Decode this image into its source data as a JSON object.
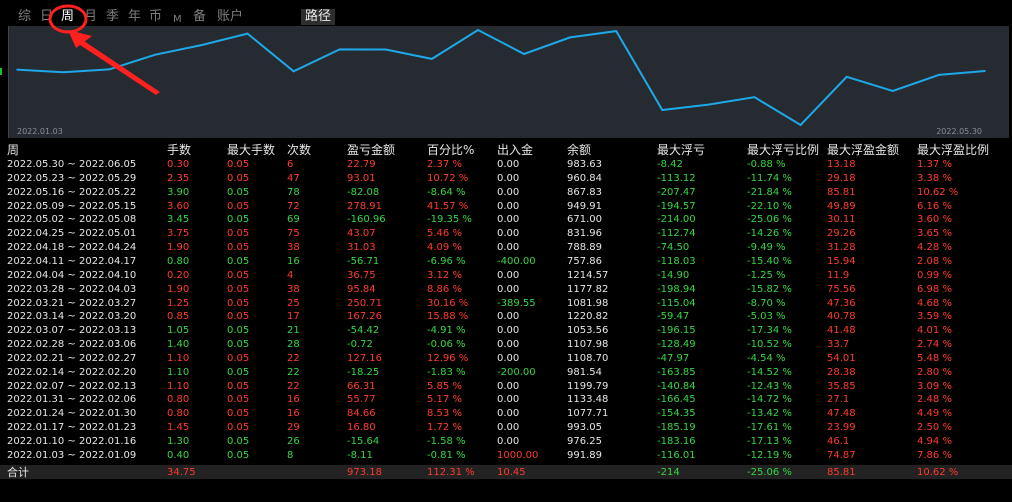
{
  "tabs": [
    "综",
    "日",
    "周",
    "月",
    "季",
    "年",
    "币",
    "M",
    "备",
    "账户"
  ],
  "active_tab": "周",
  "path_button": "路径",
  "chart_data": {
    "type": "line",
    "x_start_label": "2022.01.03",
    "x_end_label": "2022.05.30",
    "color": "#1ea8e8",
    "values": [
      991.89,
      976.25,
      993.05,
      1077.71,
      1133.48,
      1199.79,
      981.54,
      1108.7,
      1107.98,
      1053.56,
      1220.82,
      1081.98,
      1177.82,
      1214.57,
      757.86,
      788.89,
      831.96,
      671.0,
      949.91,
      867.83,
      960.84,
      983.63
    ]
  },
  "table": {
    "headers": [
      "周",
      "手数",
      "最大手数",
      "次数",
      "盈亏金额",
      "百分比%",
      "出入金",
      "余额",
      "最大浮亏",
      "最大浮亏比例",
      "最大浮盈金额",
      "最大浮盈比例"
    ],
    "rows": [
      [
        "2022.05.30 ~ 2022.06.05",
        "0.30",
        "0.05",
        "6",
        "22.79",
        "2.37 %",
        "0.00",
        "983.63",
        "-8.42",
        "-0.88 %",
        "13.18",
        "1.37 %"
      ],
      [
        "2022.05.23 ~ 2022.05.29",
        "2.35",
        "0.05",
        "47",
        "93.01",
        "10.72 %",
        "0.00",
        "960.84",
        "-113.12",
        "-11.74 %",
        "29.18",
        "3.38 %"
      ],
      [
        "2022.05.16 ~ 2022.05.22",
        "3.90",
        "0.05",
        "78",
        "-82.08",
        "-8.64 %",
        "0.00",
        "867.83",
        "-207.47",
        "-21.84 %",
        "85.81",
        "10.62 %"
      ],
      [
        "2022.05.09 ~ 2022.05.15",
        "3.60",
        "0.05",
        "72",
        "278.91",
        "41.57 %",
        "0.00",
        "949.91",
        "-194.57",
        "-22.10 %",
        "49.89",
        "6.16 %"
      ],
      [
        "2022.05.02 ~ 2022.05.08",
        "3.45",
        "0.05",
        "69",
        "-160.96",
        "-19.35 %",
        "0.00",
        "671.00",
        "-214.00",
        "-25.06 %",
        "30.11",
        "3.60 %"
      ],
      [
        "2022.04.25 ~ 2022.05.01",
        "3.75",
        "0.05",
        "75",
        "43.07",
        "5.46 %",
        "0.00",
        "831.96",
        "-112.74",
        "-14.26 %",
        "29.26",
        "3.65 %"
      ],
      [
        "2022.04.18 ~ 2022.04.24",
        "1.90",
        "0.05",
        "38",
        "31.03",
        "4.09 %",
        "0.00",
        "788.89",
        "-74.50",
        "-9.49 %",
        "31.28",
        "4.28 %"
      ],
      [
        "2022.04.11 ~ 2022.04.17",
        "0.80",
        "0.05",
        "16",
        "-56.71",
        "-6.96 %",
        "-400.00",
        "757.86",
        "-118.03",
        "-15.40 %",
        "15.94",
        "2.08 %"
      ],
      [
        "2022.04.04 ~ 2022.04.10",
        "0.20",
        "0.05",
        "4",
        "36.75",
        "3.12 %",
        "0.00",
        "1214.57",
        "-14.90",
        "-1.25 %",
        "11.9",
        "0.99 %"
      ],
      [
        "2022.03.28 ~ 2022.04.03",
        "1.90",
        "0.05",
        "38",
        "95.84",
        "8.86 %",
        "0.00",
        "1177.82",
        "-198.94",
        "-15.82 %",
        "75.56",
        "6.98 %"
      ],
      [
        "2022.03.21 ~ 2022.03.27",
        "1.25",
        "0.05",
        "25",
        "250.71",
        "30.16 %",
        "-389.55",
        "1081.98",
        "-115.04",
        "-8.70 %",
        "47.36",
        "4.68 %"
      ],
      [
        "2022.03.14 ~ 2022.03.20",
        "0.85",
        "0.05",
        "17",
        "167.26",
        "15.88 %",
        "0.00",
        "1220.82",
        "-59.47",
        "-5.03 %",
        "40.78",
        "3.59 %"
      ],
      [
        "2022.03.07 ~ 2022.03.13",
        "1.05",
        "0.05",
        "21",
        "-54.42",
        "-4.91 %",
        "0.00",
        "1053.56",
        "-196.15",
        "-17.34 %",
        "41.48",
        "4.01 %"
      ],
      [
        "2022.02.28 ~ 2022.03.06",
        "1.40",
        "0.05",
        "28",
        "-0.72",
        "-0.06 %",
        "0.00",
        "1107.98",
        "-128.49",
        "-10.52 %",
        "33.7",
        "2.74 %"
      ],
      [
        "2022.02.21 ~ 2022.02.27",
        "1.10",
        "0.05",
        "22",
        "127.16",
        "12.96 %",
        "0.00",
        "1108.70",
        "-47.97",
        "-4.54 %",
        "54.01",
        "5.48 %"
      ],
      [
        "2022.02.14 ~ 2022.02.20",
        "1.10",
        "0.05",
        "22",
        "-18.25",
        "-1.83 %",
        "-200.00",
        "981.54",
        "-163.85",
        "-14.52 %",
        "28.38",
        "2.80 %"
      ],
      [
        "2022.02.07 ~ 2022.02.13",
        "1.10",
        "0.05",
        "22",
        "66.31",
        "5.85 %",
        "0.00",
        "1199.79",
        "-140.84",
        "-12.43 %",
        "35.85",
        "3.09 %"
      ],
      [
        "2022.01.31 ~ 2022.02.06",
        "0.80",
        "0.05",
        "16",
        "55.77",
        "5.17 %",
        "0.00",
        "1133.48",
        "-166.45",
        "-14.72 %",
        "27.1",
        "2.48 %"
      ],
      [
        "2022.01.24 ~ 2022.01.30",
        "0.80",
        "0.05",
        "16",
        "84.66",
        "8.53 %",
        "0.00",
        "1077.71",
        "-154.35",
        "-13.42 %",
        "47.48",
        "4.49 %"
      ],
      [
        "2022.01.17 ~ 2022.01.23",
        "1.45",
        "0.05",
        "29",
        "16.80",
        "1.72 %",
        "0.00",
        "993.05",
        "-185.19",
        "-17.61 %",
        "23.99",
        "2.50 %"
      ],
      [
        "2022.01.10 ~ 2022.01.16",
        "1.30",
        "0.05",
        "26",
        "-15.64",
        "-1.58 %",
        "0.00",
        "976.25",
        "-183.16",
        "-17.13 %",
        "46.1",
        "4.94 %"
      ],
      [
        "2022.01.03 ~ 2022.01.09",
        "0.40",
        "0.05",
        "8",
        "-8.11",
        "-0.81 %",
        "1000.00",
        "991.89",
        "-116.01",
        "-12.19 %",
        "74.87",
        "7.86 %"
      ]
    ],
    "total": [
      "合计",
      "34.75",
      "",
      "",
      "973.18",
      "112.31 %",
      "10.45",
      "",
      "-214",
      "-25.06 %",
      "85.81",
      "10.62 %"
    ]
  },
  "colors": {
    "positive": "#ff3b30",
    "negative": "#36d645",
    "neutral": "#e6e6e6",
    "annotation": "#ff2020",
    "line": "#1ea8e8"
  }
}
